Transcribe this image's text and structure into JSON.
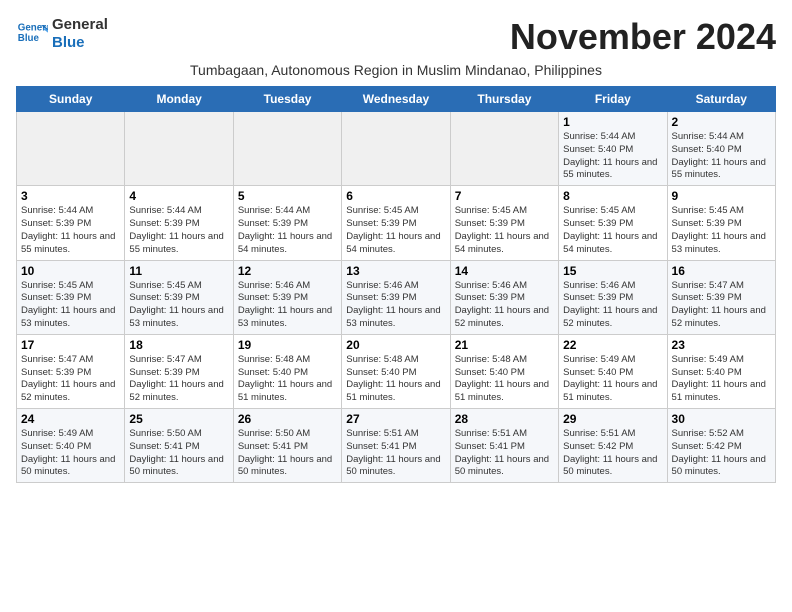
{
  "header": {
    "logo_line1": "General",
    "logo_line2": "Blue",
    "month_title": "November 2024",
    "subtitle": "Tumbagaan, Autonomous Region in Muslim Mindanao, Philippines"
  },
  "days_of_week": [
    "Sunday",
    "Monday",
    "Tuesday",
    "Wednesday",
    "Thursday",
    "Friday",
    "Saturday"
  ],
  "weeks": [
    [
      {
        "day": "",
        "detail": ""
      },
      {
        "day": "",
        "detail": ""
      },
      {
        "day": "",
        "detail": ""
      },
      {
        "day": "",
        "detail": ""
      },
      {
        "day": "",
        "detail": ""
      },
      {
        "day": "1",
        "detail": "Sunrise: 5:44 AM\nSunset: 5:40 PM\nDaylight: 11 hours and 55 minutes."
      },
      {
        "day": "2",
        "detail": "Sunrise: 5:44 AM\nSunset: 5:40 PM\nDaylight: 11 hours and 55 minutes."
      }
    ],
    [
      {
        "day": "3",
        "detail": "Sunrise: 5:44 AM\nSunset: 5:39 PM\nDaylight: 11 hours and 55 minutes."
      },
      {
        "day": "4",
        "detail": "Sunrise: 5:44 AM\nSunset: 5:39 PM\nDaylight: 11 hours and 55 minutes."
      },
      {
        "day": "5",
        "detail": "Sunrise: 5:44 AM\nSunset: 5:39 PM\nDaylight: 11 hours and 54 minutes."
      },
      {
        "day": "6",
        "detail": "Sunrise: 5:45 AM\nSunset: 5:39 PM\nDaylight: 11 hours and 54 minutes."
      },
      {
        "day": "7",
        "detail": "Sunrise: 5:45 AM\nSunset: 5:39 PM\nDaylight: 11 hours and 54 minutes."
      },
      {
        "day": "8",
        "detail": "Sunrise: 5:45 AM\nSunset: 5:39 PM\nDaylight: 11 hours and 54 minutes."
      },
      {
        "day": "9",
        "detail": "Sunrise: 5:45 AM\nSunset: 5:39 PM\nDaylight: 11 hours and 53 minutes."
      }
    ],
    [
      {
        "day": "10",
        "detail": "Sunrise: 5:45 AM\nSunset: 5:39 PM\nDaylight: 11 hours and 53 minutes."
      },
      {
        "day": "11",
        "detail": "Sunrise: 5:45 AM\nSunset: 5:39 PM\nDaylight: 11 hours and 53 minutes."
      },
      {
        "day": "12",
        "detail": "Sunrise: 5:46 AM\nSunset: 5:39 PM\nDaylight: 11 hours and 53 minutes."
      },
      {
        "day": "13",
        "detail": "Sunrise: 5:46 AM\nSunset: 5:39 PM\nDaylight: 11 hours and 53 minutes."
      },
      {
        "day": "14",
        "detail": "Sunrise: 5:46 AM\nSunset: 5:39 PM\nDaylight: 11 hours and 52 minutes."
      },
      {
        "day": "15",
        "detail": "Sunrise: 5:46 AM\nSunset: 5:39 PM\nDaylight: 11 hours and 52 minutes."
      },
      {
        "day": "16",
        "detail": "Sunrise: 5:47 AM\nSunset: 5:39 PM\nDaylight: 11 hours and 52 minutes."
      }
    ],
    [
      {
        "day": "17",
        "detail": "Sunrise: 5:47 AM\nSunset: 5:39 PM\nDaylight: 11 hours and 52 minutes."
      },
      {
        "day": "18",
        "detail": "Sunrise: 5:47 AM\nSunset: 5:39 PM\nDaylight: 11 hours and 52 minutes."
      },
      {
        "day": "19",
        "detail": "Sunrise: 5:48 AM\nSunset: 5:40 PM\nDaylight: 11 hours and 51 minutes."
      },
      {
        "day": "20",
        "detail": "Sunrise: 5:48 AM\nSunset: 5:40 PM\nDaylight: 11 hours and 51 minutes."
      },
      {
        "day": "21",
        "detail": "Sunrise: 5:48 AM\nSunset: 5:40 PM\nDaylight: 11 hours and 51 minutes."
      },
      {
        "day": "22",
        "detail": "Sunrise: 5:49 AM\nSunset: 5:40 PM\nDaylight: 11 hours and 51 minutes."
      },
      {
        "day": "23",
        "detail": "Sunrise: 5:49 AM\nSunset: 5:40 PM\nDaylight: 11 hours and 51 minutes."
      }
    ],
    [
      {
        "day": "24",
        "detail": "Sunrise: 5:49 AM\nSunset: 5:40 PM\nDaylight: 11 hours and 50 minutes."
      },
      {
        "day": "25",
        "detail": "Sunrise: 5:50 AM\nSunset: 5:41 PM\nDaylight: 11 hours and 50 minutes."
      },
      {
        "day": "26",
        "detail": "Sunrise: 5:50 AM\nSunset: 5:41 PM\nDaylight: 11 hours and 50 minutes."
      },
      {
        "day": "27",
        "detail": "Sunrise: 5:51 AM\nSunset: 5:41 PM\nDaylight: 11 hours and 50 minutes."
      },
      {
        "day": "28",
        "detail": "Sunrise: 5:51 AM\nSunset: 5:41 PM\nDaylight: 11 hours and 50 minutes."
      },
      {
        "day": "29",
        "detail": "Sunrise: 5:51 AM\nSunset: 5:42 PM\nDaylight: 11 hours and 50 minutes."
      },
      {
        "day": "30",
        "detail": "Sunrise: 5:52 AM\nSunset: 5:42 PM\nDaylight: 11 hours and 50 minutes."
      }
    ]
  ]
}
